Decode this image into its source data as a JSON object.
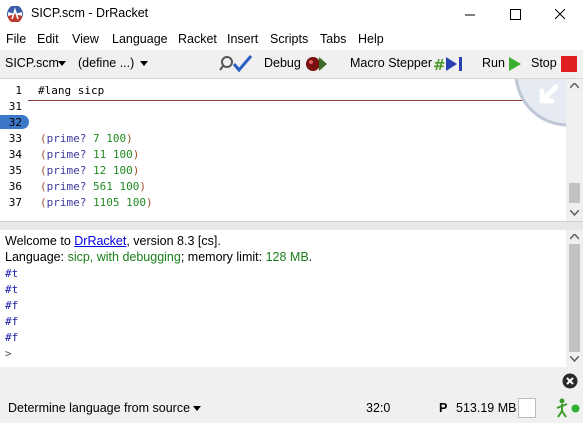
{
  "window": {
    "title": "SICP.scm - DrRacket"
  },
  "menu": [
    "File",
    "Edit",
    "View",
    "Language",
    "Racket",
    "Insert",
    "Scripts",
    "Tabs",
    "Help"
  ],
  "toolbar": {
    "file_popup": "SICP.scm",
    "define_popup": "(define ...)",
    "debug_label": "Debug",
    "macro_label": "Macro Stepper",
    "run_label": "Run",
    "stop_label": "Stop"
  },
  "editor": {
    "lang_line": {
      "number": "1",
      "text": "#lang sicp"
    },
    "lines": [
      {
        "number": "31",
        "text": ""
      },
      {
        "number": "32",
        "text": ""
      },
      {
        "number": "33",
        "fn": "prime?",
        "a": "7",
        "b": "100"
      },
      {
        "number": "34",
        "fn": "prime?",
        "a": "11",
        "b": "100"
      },
      {
        "number": "35",
        "fn": "prime?",
        "a": "12",
        "b": "100"
      },
      {
        "number": "36",
        "fn": "prime?",
        "a": "561",
        "b": "100"
      },
      {
        "number": "37",
        "fn": "prime?",
        "a": "1105",
        "b": "100"
      }
    ]
  },
  "interactions": {
    "welcome_prefix": "Welcome to ",
    "welcome_link": "DrRacket",
    "welcome_suffix": ", version 8.3 [cs].",
    "language_prefix": "Language: ",
    "language_value": "sicp, with debugging",
    "language_suffix": "; memory limit: ",
    "memory_limit": "128 MB",
    "memory_suffix": ".",
    "results": [
      "#t",
      "#t",
      "#f",
      "#f",
      "#f"
    ],
    "prompt": ">"
  },
  "status": {
    "language_selector": "Determine language from source",
    "position": "32:0",
    "p_indicator": "P",
    "memory": "513.19 MB"
  },
  "colors": {
    "keyword": "#3c3c9e",
    "number": "#228b22",
    "paren": "#a0522d",
    "link": "#0000ee",
    "language": "#1a7f1a",
    "results": "#1a1aa6",
    "stop_red": "#e02020",
    "run_green": "#3cb030"
  }
}
